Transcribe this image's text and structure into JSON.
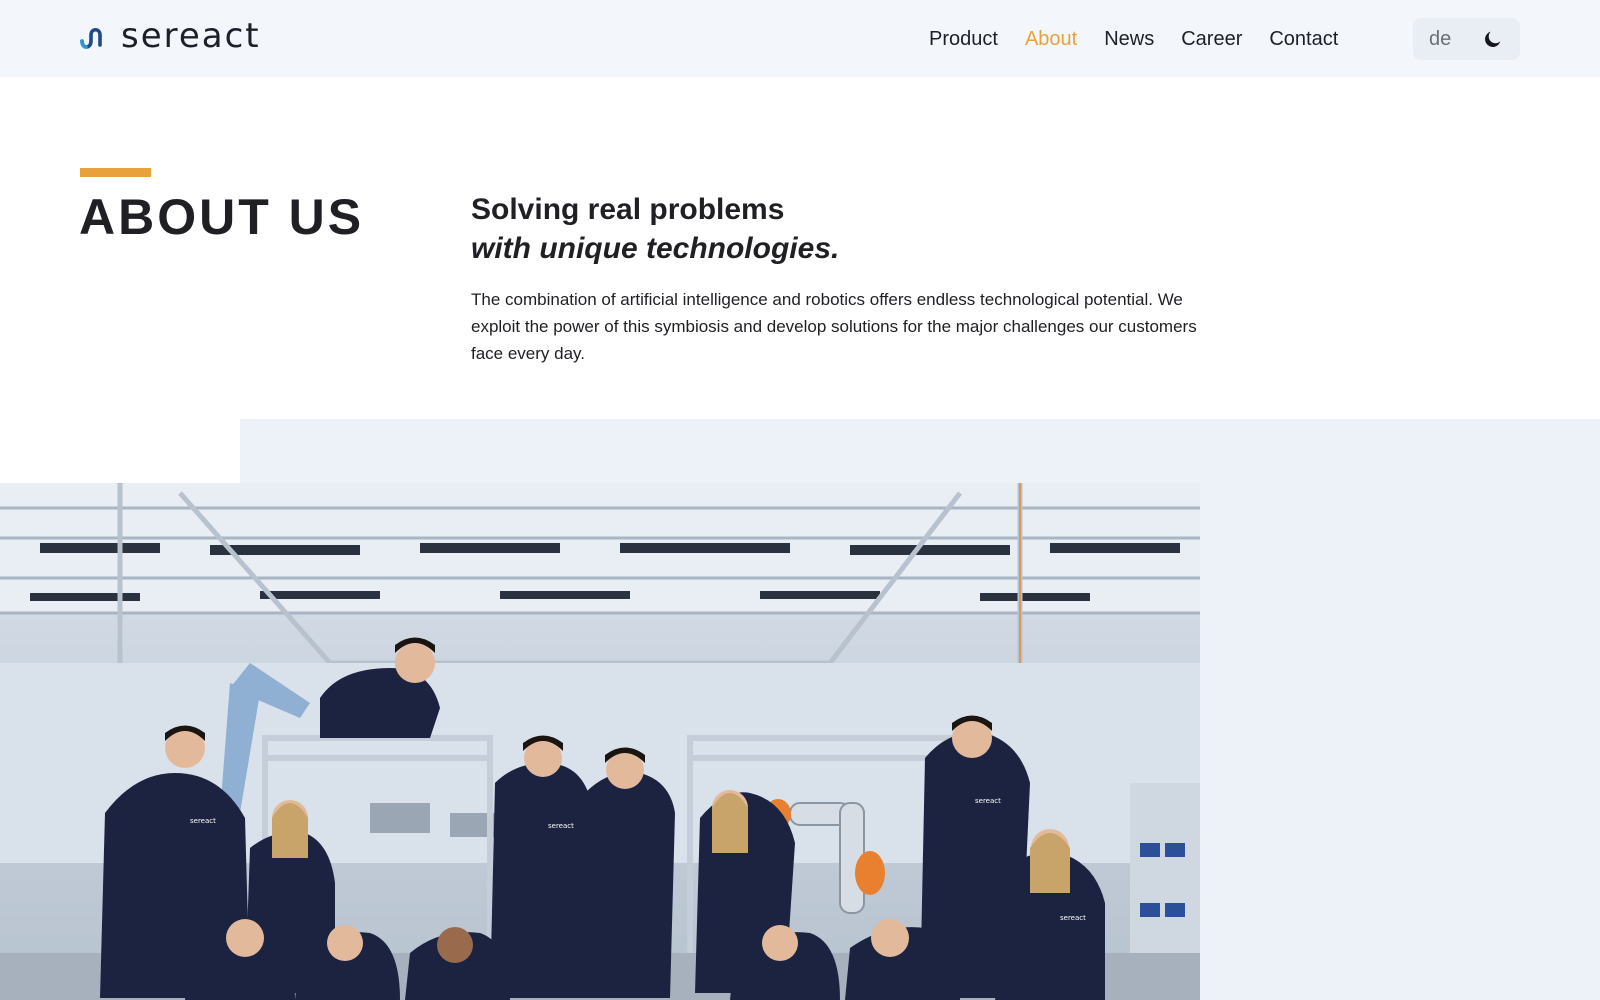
{
  "header": {
    "logo_text": "sereact",
    "nav": [
      {
        "label": "Product",
        "active": false
      },
      {
        "label": "About",
        "active": true
      },
      {
        "label": "News",
        "active": false
      },
      {
        "label": "Career",
        "active": false
      },
      {
        "label": "Contact",
        "active": false
      }
    ],
    "language": "de",
    "theme_icon": "moon-icon"
  },
  "hero": {
    "title": "ABOUT US",
    "headline_line1": "Solving real problems",
    "headline_line2": "with unique technologies.",
    "body": "The combination of artificial intelligence and robotics offers endless technological potential. We exploit the power of this symbiosis and develop solutions for the major challenges our customers face every day."
  },
  "colors": {
    "accent": "#e8a23b",
    "header_bg": "#f3f7fb",
    "panel_bg": "#edf2f8",
    "text": "#1f1f24",
    "hoodie": "#1c2340"
  },
  "image": {
    "hoodie_print": "sereact"
  }
}
